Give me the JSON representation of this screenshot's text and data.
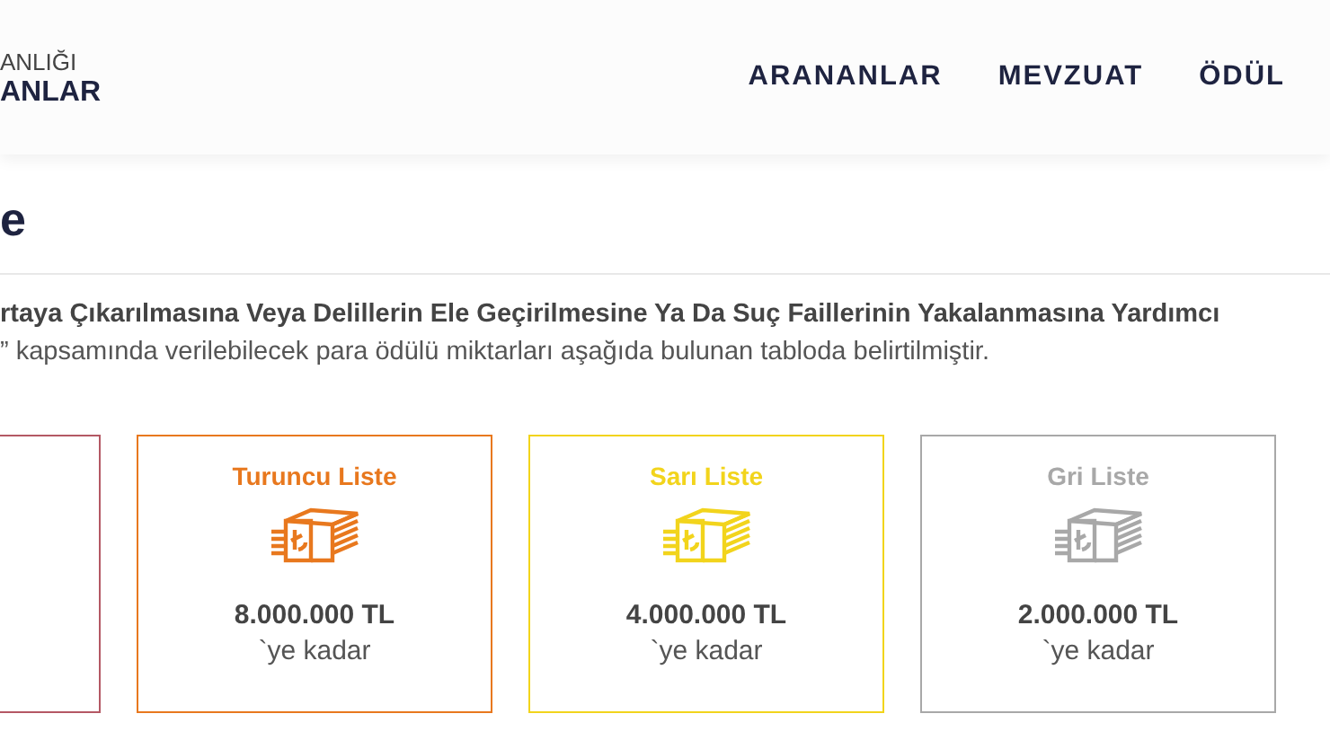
{
  "header": {
    "logo_top": "ANLIĞI",
    "logo_bottom": "ANLAR",
    "nav": [
      {
        "label": "ARANANLAR"
      },
      {
        "label": "MEVZUAT"
      },
      {
        "label": "ÖDÜL"
      }
    ]
  },
  "page_title": "e",
  "intro": {
    "line_1": "rtaya Çıkarılmasına Veya Delillerin Ele Geçirilmesine Ya Da Suç Faillerinin Yakalanmasına Yardımcı",
    "line_2": "” kapsamında verilebilecek para ödülü miktarları aşağıda bulunan tabloda belirtilmiştir."
  },
  "cards": [
    {
      "kind": "partial",
      "color": "#b45864"
    },
    {
      "kind": "full",
      "color": "#e8781e",
      "title": "Turuncu Liste",
      "amount": "8.000.000 TL",
      "suffix": "`ye kadar"
    },
    {
      "kind": "full",
      "color": "#f2d41c",
      "title": "Sarı Liste",
      "amount": "4.000.000 TL",
      "suffix": "`ye kadar"
    },
    {
      "kind": "full",
      "color": "#a8a8a8",
      "title": "Gri Liste",
      "amount": "2.000.000 TL",
      "suffix": "`ye kadar"
    }
  ]
}
